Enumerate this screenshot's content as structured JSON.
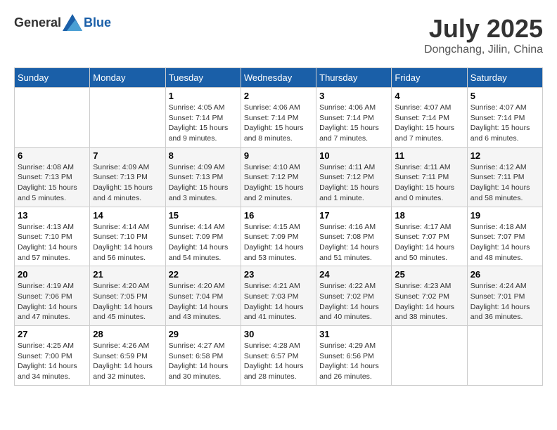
{
  "header": {
    "logo_general": "General",
    "logo_blue": "Blue",
    "month_title": "July 2025",
    "location": "Dongchang, Jilin, China"
  },
  "days_of_week": [
    "Sunday",
    "Monday",
    "Tuesday",
    "Wednesday",
    "Thursday",
    "Friday",
    "Saturday"
  ],
  "weeks": [
    [
      {
        "day": "",
        "info": ""
      },
      {
        "day": "",
        "info": ""
      },
      {
        "day": "1",
        "info": "Sunrise: 4:05 AM\nSunset: 7:14 PM\nDaylight: 15 hours and 9 minutes."
      },
      {
        "day": "2",
        "info": "Sunrise: 4:06 AM\nSunset: 7:14 PM\nDaylight: 15 hours and 8 minutes."
      },
      {
        "day": "3",
        "info": "Sunrise: 4:06 AM\nSunset: 7:14 PM\nDaylight: 15 hours and 7 minutes."
      },
      {
        "day": "4",
        "info": "Sunrise: 4:07 AM\nSunset: 7:14 PM\nDaylight: 15 hours and 7 minutes."
      },
      {
        "day": "5",
        "info": "Sunrise: 4:07 AM\nSunset: 7:14 PM\nDaylight: 15 hours and 6 minutes."
      }
    ],
    [
      {
        "day": "6",
        "info": "Sunrise: 4:08 AM\nSunset: 7:13 PM\nDaylight: 15 hours and 5 minutes."
      },
      {
        "day": "7",
        "info": "Sunrise: 4:09 AM\nSunset: 7:13 PM\nDaylight: 15 hours and 4 minutes."
      },
      {
        "day": "8",
        "info": "Sunrise: 4:09 AM\nSunset: 7:13 PM\nDaylight: 15 hours and 3 minutes."
      },
      {
        "day": "9",
        "info": "Sunrise: 4:10 AM\nSunset: 7:12 PM\nDaylight: 15 hours and 2 minutes."
      },
      {
        "day": "10",
        "info": "Sunrise: 4:11 AM\nSunset: 7:12 PM\nDaylight: 15 hours and 1 minute."
      },
      {
        "day": "11",
        "info": "Sunrise: 4:11 AM\nSunset: 7:11 PM\nDaylight: 15 hours and 0 minutes."
      },
      {
        "day": "12",
        "info": "Sunrise: 4:12 AM\nSunset: 7:11 PM\nDaylight: 14 hours and 58 minutes."
      }
    ],
    [
      {
        "day": "13",
        "info": "Sunrise: 4:13 AM\nSunset: 7:10 PM\nDaylight: 14 hours and 57 minutes."
      },
      {
        "day": "14",
        "info": "Sunrise: 4:14 AM\nSunset: 7:10 PM\nDaylight: 14 hours and 56 minutes."
      },
      {
        "day": "15",
        "info": "Sunrise: 4:14 AM\nSunset: 7:09 PM\nDaylight: 14 hours and 54 minutes."
      },
      {
        "day": "16",
        "info": "Sunrise: 4:15 AM\nSunset: 7:09 PM\nDaylight: 14 hours and 53 minutes."
      },
      {
        "day": "17",
        "info": "Sunrise: 4:16 AM\nSunset: 7:08 PM\nDaylight: 14 hours and 51 minutes."
      },
      {
        "day": "18",
        "info": "Sunrise: 4:17 AM\nSunset: 7:07 PM\nDaylight: 14 hours and 50 minutes."
      },
      {
        "day": "19",
        "info": "Sunrise: 4:18 AM\nSunset: 7:07 PM\nDaylight: 14 hours and 48 minutes."
      }
    ],
    [
      {
        "day": "20",
        "info": "Sunrise: 4:19 AM\nSunset: 7:06 PM\nDaylight: 14 hours and 47 minutes."
      },
      {
        "day": "21",
        "info": "Sunrise: 4:20 AM\nSunset: 7:05 PM\nDaylight: 14 hours and 45 minutes."
      },
      {
        "day": "22",
        "info": "Sunrise: 4:20 AM\nSunset: 7:04 PM\nDaylight: 14 hours and 43 minutes."
      },
      {
        "day": "23",
        "info": "Sunrise: 4:21 AM\nSunset: 7:03 PM\nDaylight: 14 hours and 41 minutes."
      },
      {
        "day": "24",
        "info": "Sunrise: 4:22 AM\nSunset: 7:02 PM\nDaylight: 14 hours and 40 minutes."
      },
      {
        "day": "25",
        "info": "Sunrise: 4:23 AM\nSunset: 7:02 PM\nDaylight: 14 hours and 38 minutes."
      },
      {
        "day": "26",
        "info": "Sunrise: 4:24 AM\nSunset: 7:01 PM\nDaylight: 14 hours and 36 minutes."
      }
    ],
    [
      {
        "day": "27",
        "info": "Sunrise: 4:25 AM\nSunset: 7:00 PM\nDaylight: 14 hours and 34 minutes."
      },
      {
        "day": "28",
        "info": "Sunrise: 4:26 AM\nSunset: 6:59 PM\nDaylight: 14 hours and 32 minutes."
      },
      {
        "day": "29",
        "info": "Sunrise: 4:27 AM\nSunset: 6:58 PM\nDaylight: 14 hours and 30 minutes."
      },
      {
        "day": "30",
        "info": "Sunrise: 4:28 AM\nSunset: 6:57 PM\nDaylight: 14 hours and 28 minutes."
      },
      {
        "day": "31",
        "info": "Sunrise: 4:29 AM\nSunset: 6:56 PM\nDaylight: 14 hours and 26 minutes."
      },
      {
        "day": "",
        "info": ""
      },
      {
        "day": "",
        "info": ""
      }
    ]
  ]
}
